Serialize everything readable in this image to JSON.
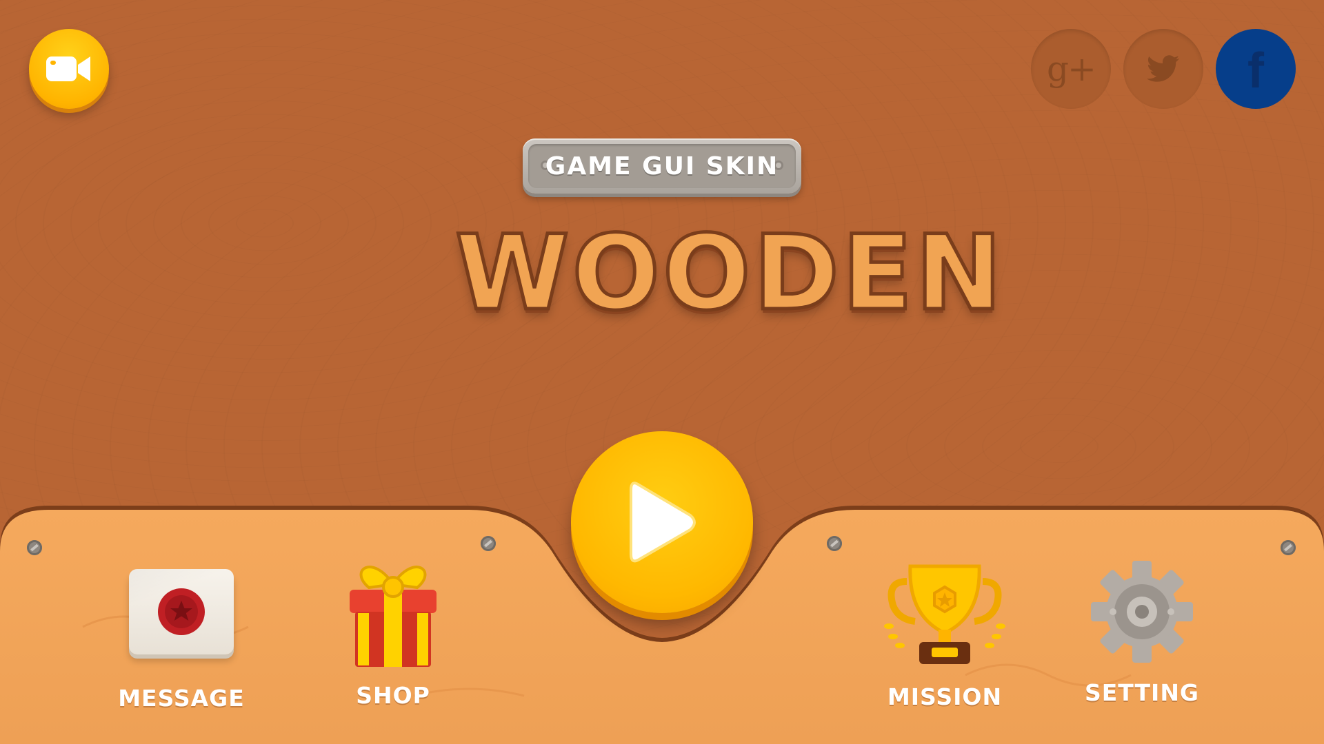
{
  "header": {
    "video_icon": "video-camera-icon",
    "social": [
      {
        "name": "google-plus",
        "glyph": "g+"
      },
      {
        "name": "twitter",
        "glyph": "twitter-bird"
      },
      {
        "name": "facebook",
        "glyph": "f"
      }
    ]
  },
  "title": {
    "plate_text": "GAME GUI SKIN",
    "main_title": "WOODEN"
  },
  "play_button": {
    "icon": "play-icon"
  },
  "menu": {
    "message_label": "MESSAGE",
    "shop_label": "SHOP",
    "mission_label": "MISSION",
    "setting_label": "SETTING"
  },
  "colors": {
    "background": "#b86534",
    "panel": "#f2a45a",
    "play": "#ffbb00",
    "facebook": "#063e8a"
  }
}
